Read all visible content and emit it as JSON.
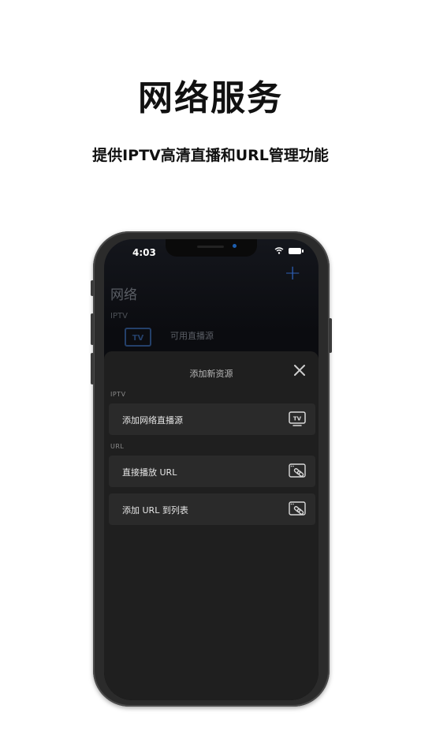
{
  "headline": "网络服务",
  "subline": "提供IPTV高清直播和URL管理功能",
  "status": {
    "time": "4:03"
  },
  "background_screen": {
    "title": "网络",
    "section": "IPTV",
    "tv_badge": "TV",
    "item": "可用直播源"
  },
  "sheet": {
    "title": "添加新资源",
    "sections": [
      {
        "label": "IPTV",
        "items": [
          {
            "label": "添加网络直播源",
            "icon": "tv-icon"
          }
        ]
      },
      {
        "label": "URL",
        "items": [
          {
            "label": "直接播放 URL",
            "icon": "link-icon"
          },
          {
            "label": "添加 URL 到列表",
            "icon": "link-icon"
          }
        ]
      }
    ]
  },
  "colors": {
    "accent": "#2d5fb4",
    "sheet_bg": "#1f1f1f",
    "row_bg": "#2a2a2a"
  }
}
